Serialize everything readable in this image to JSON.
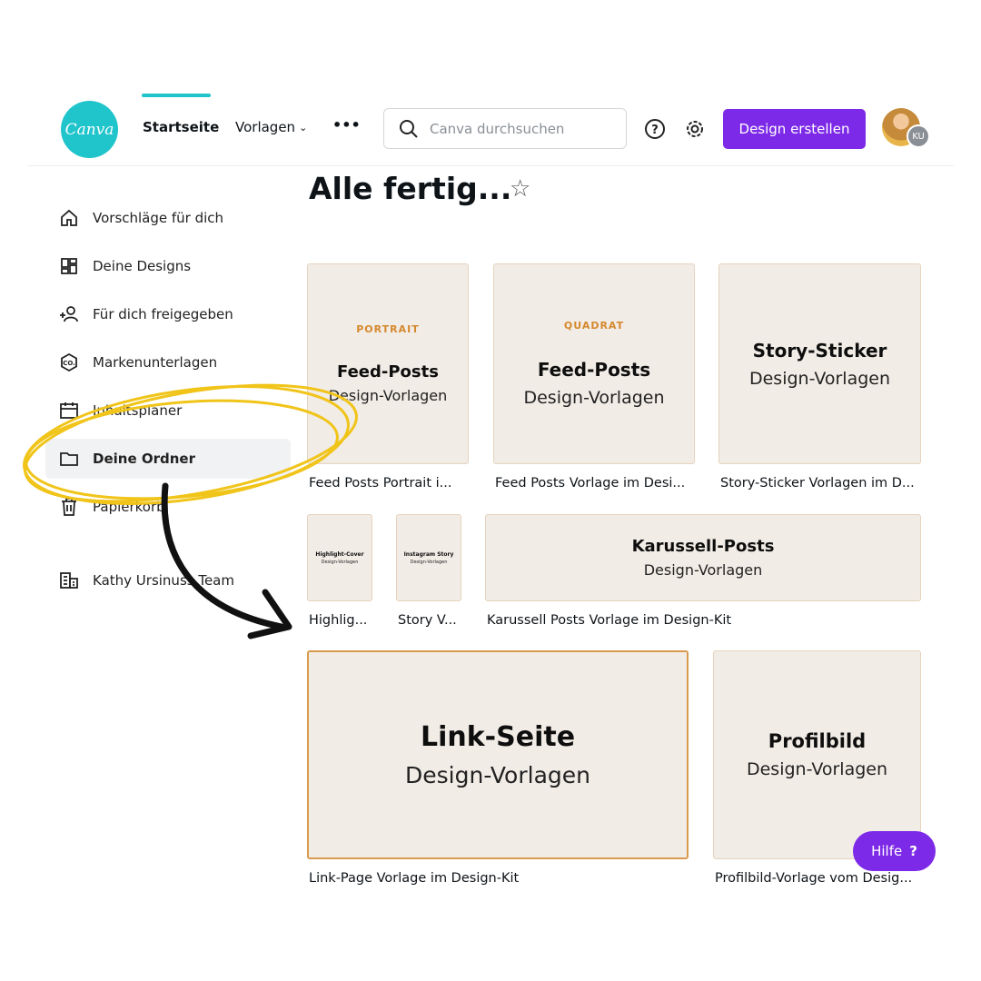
{
  "header": {
    "logo": "Canva",
    "tabs": [
      {
        "label": "Startseite",
        "active": true
      },
      {
        "label": "Vorlagen"
      }
    ],
    "more": "•••",
    "search_placeholder": "Canva durchsuchen",
    "create_button": "Design erstellen",
    "avatar_initials": "KU",
    "accent": "#7d2ae8",
    "brand": "#20c4cb"
  },
  "sidebar": {
    "items": [
      {
        "label": "Vorschläge für dich",
        "icon": "home-icon"
      },
      {
        "label": "Deine Designs",
        "icon": "grid-icon"
      },
      {
        "label": "Für dich freigegeben",
        "icon": "shared-users-icon"
      },
      {
        "label": "Markenunterlagen",
        "icon": "brand-icon"
      },
      {
        "label": "Inhaltsplaner",
        "icon": "calendar-icon"
      },
      {
        "label": "Deine Ordner",
        "icon": "folder-icon",
        "active": true
      },
      {
        "label": "Papierkorb",
        "icon": "trash-icon"
      },
      {
        "label": "Kathy Ursinuss Team",
        "icon": "team-icon"
      }
    ]
  },
  "main": {
    "title": "Alle fertig...",
    "cards": [
      {
        "tag": "PORTRAIT",
        "title": "Feed-Posts",
        "subtitle": "Design-Vorlagen",
        "caption": "Feed Posts Portrait i..."
      },
      {
        "tag": "QUADRAT",
        "title": "Feed-Posts",
        "subtitle": "Design-Vorlagen",
        "caption": "Feed Posts Vorlage im Desi..."
      },
      {
        "title": "Story-Sticker",
        "subtitle": "Design-Vorlagen",
        "caption": "Story-Sticker Vorlagen im D..."
      },
      {
        "title": "Highlight-Cover",
        "subtitle": "Design-Vorlagen",
        "caption": "Highlig..."
      },
      {
        "title": "Instagram Story",
        "subtitle": "Design-Vorlagen",
        "caption": "Story V..."
      },
      {
        "title": "Karussell-Posts",
        "subtitle": "Design-Vorlagen",
        "caption": "Karussell Posts Vorlage im Design-Kit"
      },
      {
        "title": "Link-Seite",
        "subtitle": "Design-Vorlagen",
        "caption": "Link-Page Vorlage im Design-Kit"
      },
      {
        "title": "Profilbild",
        "subtitle": "Design-Vorlagen",
        "caption": "Profilbild-Vorlage vom Desig..."
      }
    ]
  },
  "help_button": "Hilfe",
  "help_icon": "?"
}
